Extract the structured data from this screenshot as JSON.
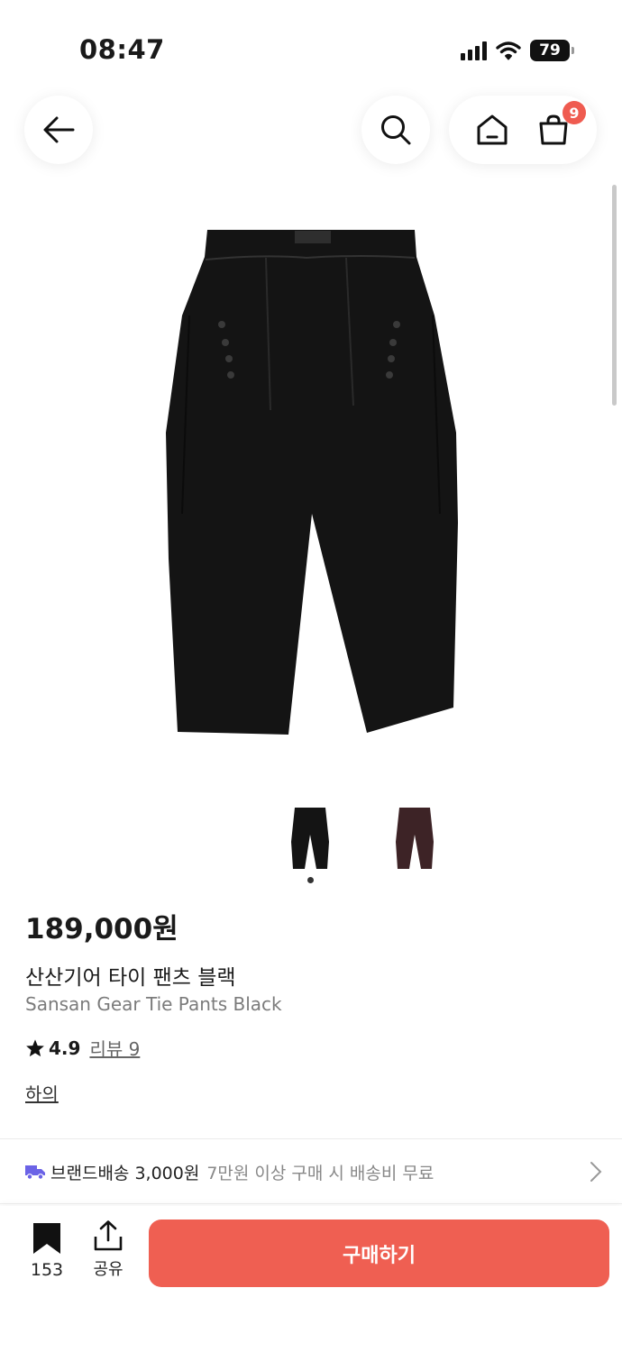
{
  "status_bar": {
    "time": "08:47",
    "battery": "79"
  },
  "header": {
    "back_icon": "arrow-left-icon",
    "search_icon": "search-icon",
    "home_icon": "home-icon",
    "cart_icon": "shopping-bag-icon",
    "cart_badge": "9"
  },
  "product": {
    "price": "189,000원",
    "name_ko": "산산기어 타이 팬츠 블랙",
    "name_en": "Sansan Gear Tie Pants Black",
    "rating": "4.9",
    "review_link": "리뷰 9",
    "category": "하의",
    "thumbnails": [
      "black",
      "burgundy"
    ],
    "colors": {
      "black": "#141414",
      "burgundy": "#3d2326"
    }
  },
  "shipping": {
    "label": "브랜드배송 3,000원",
    "note": "7만원 이상 구매 시 배송비 무료",
    "truck_color": "#6b63e6"
  },
  "bottom": {
    "bookmark_count": "153",
    "share_label": "공유",
    "buy_label": "구매하기",
    "accent": "#ef5f52"
  }
}
